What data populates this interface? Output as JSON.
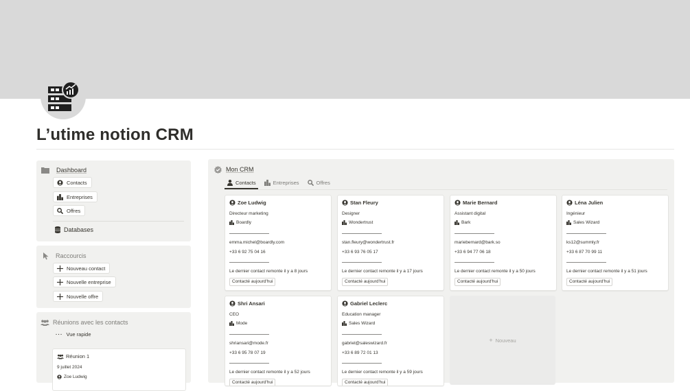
{
  "page": {
    "title": "L’utime notion CRM"
  },
  "dashboard": {
    "title": "Dashboard",
    "buttons": [
      {
        "label": "Contacts",
        "icon": "person-icon"
      },
      {
        "label": "Entreprises",
        "icon": "building-icon"
      },
      {
        "label": "Offres",
        "icon": "magnifier-icon"
      }
    ],
    "databases_label": "Databases"
  },
  "shortcuts": {
    "title": "Raccourcis",
    "buttons": [
      {
        "label": "Nouveau contact"
      },
      {
        "label": "Nouvelle entreprise"
      },
      {
        "label": "Nouvelle offre"
      }
    ]
  },
  "meetings": {
    "title": "Réunions avec les contacts",
    "view_label": "Vue rapide",
    "card": {
      "title": "Réunion 1",
      "date": "9 juillet 2024",
      "contact": "Zoe Ludwig"
    }
  },
  "crm": {
    "title": "Mon CRM",
    "tabs": [
      {
        "label": "Contacts",
        "active": true
      },
      {
        "label": "Entreprises",
        "active": false
      },
      {
        "label": "Offres",
        "active": false
      }
    ],
    "new_label": "Nouveau",
    "cards": [
      {
        "name": "Zoe Ludwig",
        "role": "Directeur marketing",
        "company": "Boardly",
        "email": "emma.michel@boardly.com",
        "phone": "+33 6 92 75 04 16",
        "last_contact": "Le dernier contact remonte il y a 8 jours",
        "tag": "Contacté aujourd'hui"
      },
      {
        "name": "Stan Fleury",
        "role": "Designer",
        "company": "Wondertrust",
        "email": "stan.fleury@wondertrust.fr",
        "phone": "+33 6 93 76 05 17",
        "last_contact": "Le dernier contact remonte il y a 17 jours",
        "tag": "Contacté aujourd'hui"
      },
      {
        "name": "Marie Bernard",
        "role": "Assistant digital",
        "company": "Bark",
        "email": "mariebernard@bark.so",
        "phone": "+33 6 94 77 06 18",
        "last_contact": "Le dernier contact remonte il y a 50 jours",
        "tag": "Contacté aujourd'hui"
      },
      {
        "name": "Léna Julien",
        "role": "Ingénieur",
        "company": "Sales Wizard",
        "email": "ks12@summly.fr",
        "phone": "+33 6 87 70 99 11",
        "last_contact": "Le dernier contact remonte il y a 51 jours",
        "tag": "Contacté aujourd'hui"
      },
      {
        "name": "Shri Ansari",
        "role": "CEO",
        "company": "Mode",
        "email": "shriansari@mode.fr",
        "phone": "+33 6 95 78 07 19",
        "last_contact": "Le dernier contact remonte il y a 52 jours",
        "tag": "Contacté aujourd'hui"
      },
      {
        "name": "Gabriel Leclerc",
        "role": "Education manager",
        "company": "Sales Wizard",
        "email": "gabriel@saleswizard.fr",
        "phone": "+33 6 89 72 01 13",
        "last_contact": "Le dernier contact remonte il y a 59 jours",
        "tag": "Contacté aujourd'hui"
      }
    ]
  },
  "colors": {
    "cover": "#d9d9d9",
    "panel": "#f1f1ef",
    "text": "#37352f",
    "muted": "#7d7c78"
  }
}
